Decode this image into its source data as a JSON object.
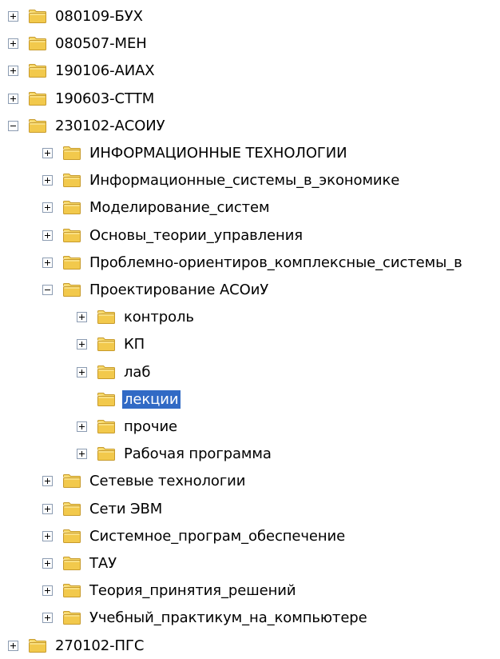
{
  "colors": {
    "folder_fill": "#f2c94c",
    "folder_tab": "#f7d96a",
    "folder_edge": "#c79a2b",
    "selection": "#316ac5",
    "toggle_border": "#8c9cb2"
  },
  "icons": {
    "expand": "plus-box-icon",
    "collapse": "minus-box-icon",
    "folder": "folder-icon"
  },
  "tree": [
    {
      "label": "080109-БУХ",
      "depth": 0,
      "toggle": "plus"
    },
    {
      "label": "080507-МЕН",
      "depth": 0,
      "toggle": "plus"
    },
    {
      "label": "190106-АИАХ",
      "depth": 0,
      "toggle": "plus"
    },
    {
      "label": "190603-СТТМ",
      "depth": 0,
      "toggle": "plus"
    },
    {
      "label": "230102-АСОИУ",
      "depth": 0,
      "toggle": "minus"
    },
    {
      "label": "ИНФОРМАЦИОННЫЕ ТЕХНОЛОГИИ",
      "depth": 1,
      "toggle": "plus"
    },
    {
      "label": "Информационные_системы_в_экономике",
      "depth": 1,
      "toggle": "plus"
    },
    {
      "label": "Моделирование_систем",
      "depth": 1,
      "toggle": "plus"
    },
    {
      "label": "Основы_теории_управления",
      "depth": 1,
      "toggle": "plus"
    },
    {
      "label": "Проблемно-ориентиров_комплексные_системы_в",
      "depth": 1,
      "toggle": "plus"
    },
    {
      "label": "Проектирование АСОиУ",
      "depth": 1,
      "toggle": "minus"
    },
    {
      "label": "контроль",
      "depth": 2,
      "toggle": "plus"
    },
    {
      "label": "КП",
      "depth": 2,
      "toggle": "plus"
    },
    {
      "label": "лаб",
      "depth": 2,
      "toggle": "plus"
    },
    {
      "label": "лекции",
      "depth": 2,
      "toggle": "none",
      "selected": true
    },
    {
      "label": "прочие",
      "depth": 2,
      "toggle": "plus"
    },
    {
      "label": "Рабочая программа",
      "depth": 2,
      "toggle": "plus"
    },
    {
      "label": "Сетевые технологии",
      "depth": 1,
      "toggle": "plus"
    },
    {
      "label": "Сети ЭВМ",
      "depth": 1,
      "toggle": "plus"
    },
    {
      "label": "Системное_програм_обеспечение",
      "depth": 1,
      "toggle": "plus"
    },
    {
      "label": "ТАУ",
      "depth": 1,
      "toggle": "plus"
    },
    {
      "label": "Теория_принятия_решений",
      "depth": 1,
      "toggle": "plus"
    },
    {
      "label": "Учебный_практикум_на_компьютере",
      "depth": 1,
      "toggle": "plus"
    },
    {
      "label": "270102-ПГС",
      "depth": 0,
      "toggle": "plus"
    }
  ]
}
